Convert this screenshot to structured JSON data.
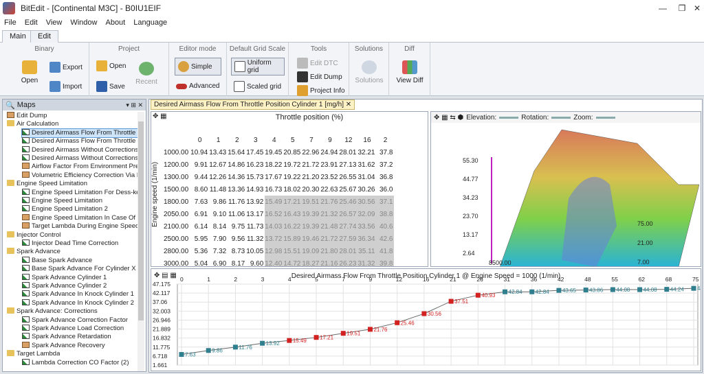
{
  "app": {
    "title": "BitEdit - [Continental M3C] - B0IU1EIF"
  },
  "menu": [
    "File",
    "Edit",
    "View",
    "Window",
    "About",
    "Language"
  ],
  "ribbon_tabs": [
    "Main",
    "Edit"
  ],
  "ribbon": {
    "binary": {
      "title": "Binary",
      "open": "Open",
      "export": "Export",
      "import": "Import"
    },
    "project": {
      "title": "Project",
      "open": "Open",
      "save": "Save",
      "recent": "Recent"
    },
    "editor_mode": {
      "title": "Editor mode",
      "simple": "Simple",
      "advanced": "Advanced"
    },
    "grid_scale": {
      "title": "Default Grid Scale",
      "uniform": "Uniform grid",
      "scaled": "Scaled grid"
    },
    "tools": {
      "title": "Tools",
      "edit_dtc": "Edit DTC",
      "edit_dump": "Edit Dump",
      "project_info": "Project Info"
    },
    "solutions": {
      "title": "Solutions",
      "solutions": "Solutions"
    },
    "diff": {
      "title": "Diff",
      "view_diff": "View Diff"
    }
  },
  "maps": {
    "title": "Maps",
    "items": [
      {
        "t": "Edit Dump",
        "lvl": 0,
        "i": "grid"
      },
      {
        "t": "Air Calculation",
        "lvl": 0,
        "i": "fold"
      },
      {
        "t": "Desired Airmass Flow From Throttle Pos",
        "lvl": 1,
        "i": "graph",
        "sel": true
      },
      {
        "t": "Desired Airmass Flow From Throttle Pos",
        "lvl": 1,
        "i": "graph"
      },
      {
        "t": "Desired Airmass Without Corrections Cy",
        "lvl": 1,
        "i": "graph"
      },
      {
        "t": "Desired Airmass Without Corrections Cy",
        "lvl": 1,
        "i": "graph"
      },
      {
        "t": "Airflow Factor From Environment Pressu",
        "lvl": 1,
        "i": "grid"
      },
      {
        "t": "Volumetric Efficiency Correction Via Inta",
        "lvl": 1,
        "i": "grid"
      },
      {
        "t": "Engine Speed Limitation",
        "lvl": 0,
        "i": "fold"
      },
      {
        "t": "Engine Speed Limitation For Dess-key",
        "lvl": 1,
        "i": "graph"
      },
      {
        "t": "Engine Speed Limitation",
        "lvl": 1,
        "i": "graph"
      },
      {
        "t": "Engine Speed Limitation 2",
        "lvl": 1,
        "i": "graph"
      },
      {
        "t": "Engine Speed Limitation In Case Of Syst",
        "lvl": 1,
        "i": "grid"
      },
      {
        "t": "Target Lambda During Engine Speed Lir",
        "lvl": 1,
        "i": "grid"
      },
      {
        "t": "Injector Control",
        "lvl": 0,
        "i": "fold"
      },
      {
        "t": "Injector Dead Time Correction",
        "lvl": 1,
        "i": "graph"
      },
      {
        "t": "Spark Advance",
        "lvl": 0,
        "i": "fold"
      },
      {
        "t": "Base Spark Advance",
        "lvl": 1,
        "i": "graph"
      },
      {
        "t": "Base Spark Advance For Cylinder X (2)",
        "lvl": 1,
        "i": "graph"
      },
      {
        "t": "Spark Advance Cylinder 1",
        "lvl": 1,
        "i": "graph"
      },
      {
        "t": "Spark Advance Cylinder 2",
        "lvl": 1,
        "i": "graph"
      },
      {
        "t": "Spark Advance In Knock Cylinder 1",
        "lvl": 1,
        "i": "graph"
      },
      {
        "t": "Spark Advance In Knock Cylinder 2",
        "lvl": 1,
        "i": "graph"
      },
      {
        "t": "Spark Advance: Corrections",
        "lvl": 0,
        "i": "fold"
      },
      {
        "t": "Spark Advance Correction Factor",
        "lvl": 1,
        "i": "graph"
      },
      {
        "t": "Spark Advance Load Correction",
        "lvl": 1,
        "i": "graph"
      },
      {
        "t": "Spark Advance Retardation",
        "lvl": 1,
        "i": "graph"
      },
      {
        "t": "Spark Advance Recovery",
        "lvl": 1,
        "i": "grid"
      },
      {
        "t": "Target Lambda",
        "lvl": 0,
        "i": "fold"
      },
      {
        "t": "Lambda Correction CO Factor (2)",
        "lvl": 1,
        "i": "graph"
      }
    ]
  },
  "document": {
    "tab": "Desired Airmass Flow From Throttle Position Cylinder 1 [mg/h]"
  },
  "table": {
    "x_title": "Throttle position (%)",
    "y_title": "Engine speed (1/min)",
    "x_axis": [
      "0",
      "1",
      "2",
      "3",
      "4",
      "5",
      "7",
      "9",
      "12",
      "16",
      "2"
    ],
    "rows": [
      {
        "rpm": "1000.00",
        "v": [
          "10.94",
          "13.43",
          "15.64",
          "17.45",
          "19.45",
          "20.85",
          "22.96",
          "24.94",
          "28.01",
          "32.21",
          "37.8"
        ],
        "g": 0
      },
      {
        "rpm": "1200.00",
        "v": [
          "9.91",
          "12.67",
          "14.86",
          "16.23",
          "18.22",
          "19.72",
          "21.72",
          "23.91",
          "27.13",
          "31.62",
          "37.2"
        ],
        "g": 0
      },
      {
        "rpm": "1300.00",
        "v": [
          "9.44",
          "12.26",
          "14.36",
          "15.73",
          "17.67",
          "19.22",
          "21.20",
          "23.52",
          "26.55",
          "31.04",
          "36.8"
        ],
        "g": 0
      },
      {
        "rpm": "1500.00",
        "v": [
          "8.60",
          "11.48",
          "13.36",
          "14.93",
          "16.73",
          "18.02",
          "20.30",
          "22.63",
          "25.67",
          "30.26",
          "36.0"
        ],
        "g": 0
      },
      {
        "rpm": "1800.00",
        "v": [
          "7.63",
          "9.86",
          "11.76",
          "13.92",
          "15.49",
          "17.21",
          "19.51",
          "21.76",
          "25.46",
          "30.56",
          "37.1"
        ],
        "g": 4
      },
      {
        "rpm": "2050.00",
        "v": [
          "6.91",
          "9.10",
          "11.06",
          "13.17",
          "16.52",
          "16.43",
          "19.39",
          "21.32",
          "26.57",
          "32.09",
          "38.8"
        ],
        "g": 4
      },
      {
        "rpm": "2100.00",
        "v": [
          "6.14",
          "8.14",
          "9.75",
          "11.73",
          "14.03",
          "16.22",
          "19.39",
          "21.48",
          "27.74",
          "33.56",
          "40.6"
        ],
        "g": 4
      },
      {
        "rpm": "2500.00",
        "v": [
          "5.95",
          "7.90",
          "9.56",
          "11.32",
          "13.72",
          "15.89",
          "19.46",
          "21.72",
          "27.59",
          "36.34",
          "42.6"
        ],
        "g": 4
      },
      {
        "rpm": "2800.00",
        "v": [
          "5.36",
          "7.32",
          "8.73",
          "10.05",
          "12.98",
          "15.51",
          "19.09",
          "21.80",
          "28.01",
          "35.11",
          "41.8"
        ],
        "g": 4
      },
      {
        "rpm": "3000.00",
        "v": [
          "5.04",
          "6.90",
          "8.17",
          "9.60",
          "12.40",
          "14.72",
          "18.27",
          "21.16",
          "26.23",
          "31.32",
          "39.8"
        ],
        "g": 4
      },
      {
        "rpm": "3100.00",
        "v": [
          "4.89",
          "6.83",
          "7.84",
          "9.16",
          "12.17",
          "14.55",
          "18.01",
          "20.98",
          "26.01",
          "31.05",
          "39.4"
        ],
        "g": 4
      }
    ]
  },
  "plot3d": {
    "labels": [
      "55.30",
      "44.77",
      "34.23",
      "23.70",
      "13.17",
      "2.64"
    ],
    "right_labels": [
      "75.00",
      "21.00",
      "7.00"
    ],
    "bottom_label": "8500.00",
    "elevation": "Elevation:",
    "rotation": "Rotation:",
    "zoom": "Zoom:"
  },
  "chart_data": {
    "type": "line",
    "title": "Desired Airmass Flow From Throttle Position Cylinder 1 @ Engine Speed = 1000 (1/min)",
    "x": [
      "0",
      "1",
      "2",
      "3",
      "4",
      "5",
      "7",
      "9",
      "12",
      "16",
      "21",
      "26",
      "31",
      "36",
      "42",
      "48",
      "55",
      "62",
      "68",
      "75"
    ],
    "values": [
      7.63,
      9.86,
      11.76,
      13.92,
      15.49,
      17.21,
      19.51,
      21.76,
      25.46,
      30.56,
      37.51,
      40.93,
      42.84,
      42.84,
      43.65,
      43.86,
      44.08,
      44.08,
      44.24,
      44.8
    ],
    "labels": [
      "7.63",
      "9.86",
      "11.76",
      "13.92",
      "15.49",
      "17.21",
      "19.51",
      "21.76",
      "25.46",
      "30.56",
      "37.51",
      "40.93",
      "42.84",
      "42.84",
      "43.65",
      "43.86",
      "44.08",
      "44.08",
      "44.24",
      "44.8"
    ],
    "y_ticks": [
      "47.175",
      "42.117",
      "37.06",
      "32.003",
      "26.946",
      "21.889",
      "16.832",
      "11.775",
      "6.718",
      "1.661"
    ],
    "ylim": [
      1.661,
      47.175
    ],
    "colors": {
      "teal": "#2f7f8f",
      "red": "#d32020"
    },
    "marker": [
      "t",
      "t",
      "t",
      "t",
      "r",
      "r",
      "r",
      "r",
      "r",
      "r",
      "r",
      "r",
      "t",
      "t",
      "t",
      "t",
      "t",
      "t",
      "t",
      "t"
    ]
  }
}
